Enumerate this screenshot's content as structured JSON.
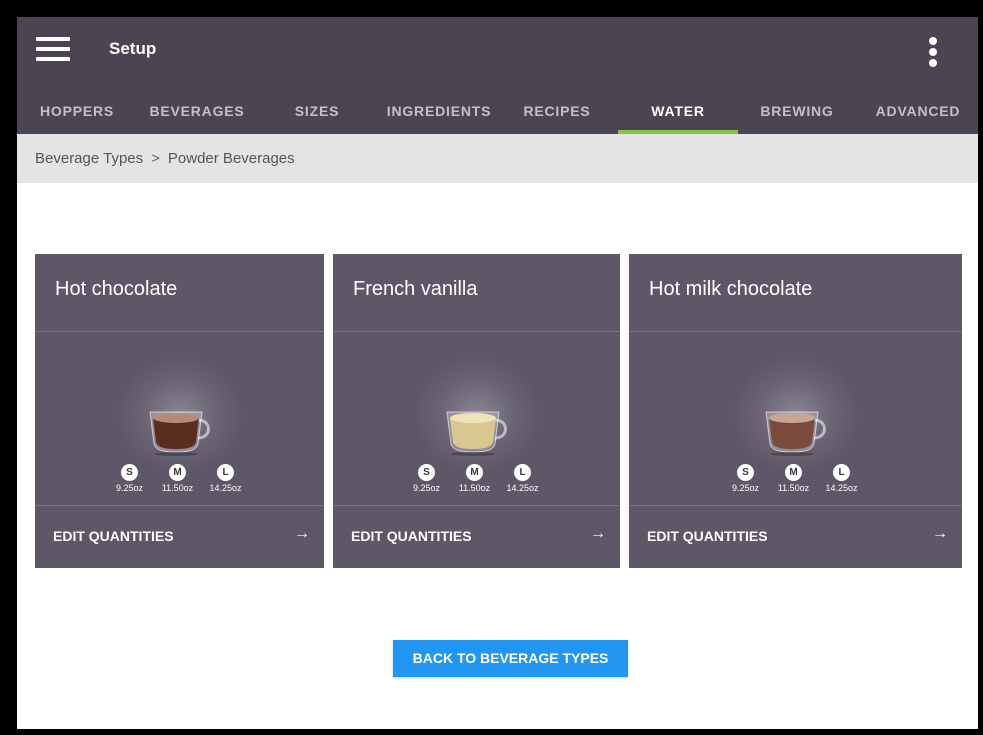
{
  "header": {
    "title": "Setup",
    "menu_icon": "hamburger-menu-icon",
    "more_icon": "more-vert-icon"
  },
  "tabs": [
    {
      "label": "HOPPERS",
      "active": false
    },
    {
      "label": "BEVERAGES",
      "active": false
    },
    {
      "label": "SIZES",
      "active": false
    },
    {
      "label": "INGREDIENTS",
      "active": false
    },
    {
      "label": "RECIPES",
      "active": false
    },
    {
      "label": "WATER",
      "active": true
    },
    {
      "label": "BREWING",
      "active": false
    },
    {
      "label": "ADVANCED",
      "active": false
    }
  ],
  "breadcrumb": {
    "parent": "Beverage Types",
    "separator": ">",
    "current": "Powder Beverages"
  },
  "cards": [
    {
      "title": "Hot chocolate",
      "drink_color": "#5a2e1f",
      "foam_color": "#b58a78",
      "sizes": [
        {
          "badge": "S",
          "oz": "9.25oz"
        },
        {
          "badge": "M",
          "oz": "11.50oz"
        },
        {
          "badge": "L",
          "oz": "14.25oz"
        }
      ],
      "action": "EDIT QUANTITIES"
    },
    {
      "title": "French vanilla",
      "drink_color": "#d9c790",
      "foam_color": "#efe3b8",
      "sizes": [
        {
          "badge": "S",
          "oz": "9.25oz"
        },
        {
          "badge": "M",
          "oz": "11.50oz"
        },
        {
          "badge": "L",
          "oz": "14.25oz"
        }
      ],
      "action": "EDIT QUANTITIES"
    },
    {
      "title": "Hot milk chocolate",
      "drink_color": "#7a4a3a",
      "foam_color": "#c9a596",
      "sizes": [
        {
          "badge": "S",
          "oz": "9.25oz"
        },
        {
          "badge": "M",
          "oz": "11.50oz"
        },
        {
          "badge": "L",
          "oz": "14.25oz"
        }
      ],
      "action": "EDIT QUANTITIES"
    }
  ],
  "arrow_glyph": "→",
  "back_button": "BACK TO BEVERAGE TYPES",
  "colors": {
    "appbar": "#4b4553",
    "active_tab_indicator": "#8bc34a",
    "card_bg": "#5d5768",
    "primary_button": "#2196f3"
  }
}
